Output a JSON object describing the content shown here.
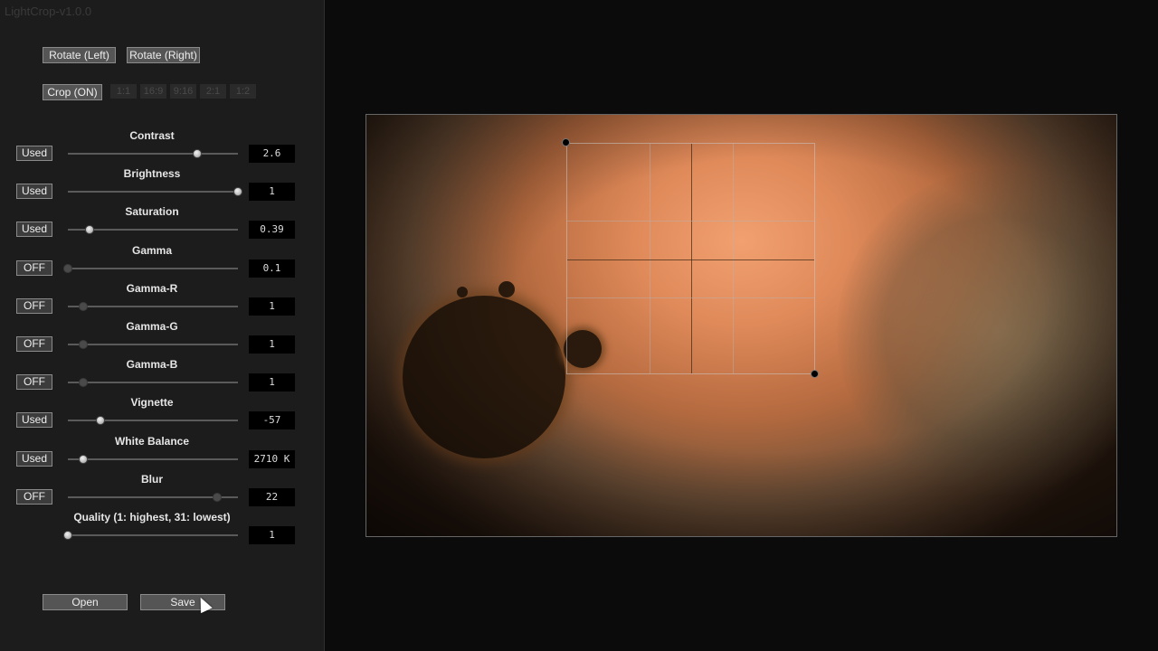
{
  "app": {
    "title": "LightCrop-v1.0.0"
  },
  "rotate": {
    "left_label": "Rotate (Left)",
    "right_label": "Rotate (Right)"
  },
  "crop": {
    "toggle_label": "Crop (ON)",
    "ratios": [
      "1:1",
      "16:9",
      "9:16",
      "2:1",
      "1:2"
    ]
  },
  "sliders": [
    {
      "label": "Contrast",
      "state": "Used",
      "value": "2.6",
      "level": 0.76
    },
    {
      "label": "Brightness",
      "state": "Used",
      "value": "1",
      "level": 1.0
    },
    {
      "label": "Saturation",
      "state": "Used",
      "value": "0.39",
      "level": 0.13
    },
    {
      "label": "Gamma",
      "state": "OFF",
      "value": "0.1",
      "level": 0.0
    },
    {
      "label": "Gamma-R",
      "state": "OFF",
      "value": "1",
      "level": 0.09
    },
    {
      "label": "Gamma-G",
      "state": "OFF",
      "value": "1",
      "level": 0.09
    },
    {
      "label": "Gamma-B",
      "state": "OFF",
      "value": "1",
      "level": 0.09
    },
    {
      "label": "Vignette",
      "state": "Used",
      "value": "-57",
      "level": 0.19
    },
    {
      "label": "White Balance",
      "state": "Used",
      "value": "2710 K",
      "level": 0.09
    },
    {
      "label": "Blur",
      "state": "OFF",
      "value": "22",
      "level": 0.88
    },
    {
      "label": "Quality (1: highest, 31: lowest)",
      "state": "",
      "value": "1",
      "level": 0.0
    }
  ],
  "footer": {
    "open_label": "Open",
    "save_label": "Save"
  },
  "colors": {
    "accent_off": "#4a4a4a",
    "panel": "#1c1c1c"
  }
}
